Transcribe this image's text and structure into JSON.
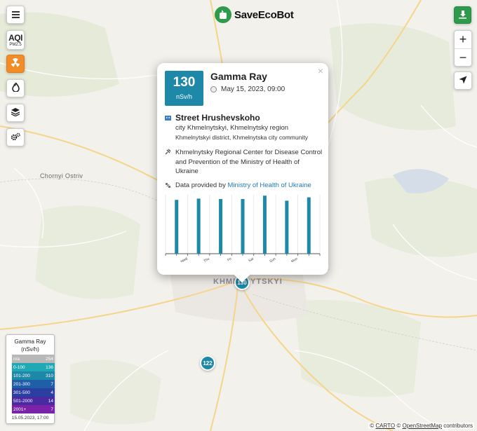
{
  "brand": {
    "name": "SaveEcoBot"
  },
  "controls": {
    "menu_icon": "menu-icon",
    "aqi_label": "AQI",
    "aqi_sub": "PM2.5",
    "radiation_icon": "radiation-icon",
    "fire_icon": "fire-icon",
    "layers_icon": "layers-icon",
    "settings_icon": "gears-icon",
    "zoom_in": "+",
    "zoom_out": "−",
    "locate_icon": "location-arrow-icon",
    "share_icon": "share-icon",
    "accent_color": "#f28c28",
    "brand_green": "#2e9a4b"
  },
  "map": {
    "places": [
      "Chornyi Ostriv",
      "KHMELNYTSKYI"
    ],
    "markers": [
      {
        "label": "130",
        "color": "#1e88a8"
      },
      {
        "label": "122",
        "color": "#1e88a8"
      }
    ]
  },
  "popup": {
    "value": "130",
    "unit": "nSv/h",
    "title": "Gamma Ray",
    "date": "May 15, 2023, 09:00",
    "close": "×",
    "street": "Street Hrushevskoho",
    "city": "city Khmelnytskyi, Khmelnytsky region",
    "district": "Khmelnytskyi district, Khmelnytska city community",
    "organization": "Khmelnytsky Regional Center for Disease Control and Prevention of the Ministry of Health of Ukraine",
    "provider_prefix": "Data provided by",
    "provider_link": "Ministry of Health of Ukraine",
    "badge_color": "#1e88a8"
  },
  "chart_data": {
    "type": "bar",
    "categories": [
      "Wed",
      "Thu",
      "Fri",
      "Sat",
      "Sun",
      "Mon"
    ],
    "values": [
      128,
      131,
      130,
      130,
      138,
      126,
      134
    ],
    "tick_labels": [
      "Wed",
      "Thu",
      "Fri",
      "Sat",
      "Sun",
      "Mon"
    ],
    "ylim": [
      0,
      140
    ],
    "color": "#1e88a8",
    "grid": true
  },
  "legend": {
    "title": "Gamma Ray",
    "unit": "(nSv/h)",
    "rows": [
      {
        "range": "n/a",
        "count": "254",
        "color": "#b8b8b8"
      },
      {
        "range": "0-100",
        "count": "136",
        "color": "#21a8b5"
      },
      {
        "range": "101-200",
        "count": "310",
        "color": "#1e88a8"
      },
      {
        "range": "201-300",
        "count": "7",
        "color": "#1f5fa8"
      },
      {
        "range": "301-500",
        "count": "4",
        "color": "#2a3fa0"
      },
      {
        "range": "501-2000",
        "count": "14",
        "color": "#4a2aa0"
      },
      {
        "range": "2001+",
        "count": "7",
        "color": "#7a22a8"
      }
    ],
    "date": "15.05.2023, 17:00"
  },
  "attribution": {
    "c1": "©",
    "carto": "CARTO",
    "c2": "©",
    "osm": "OpenStreetMap",
    "contrib": "contributors"
  }
}
